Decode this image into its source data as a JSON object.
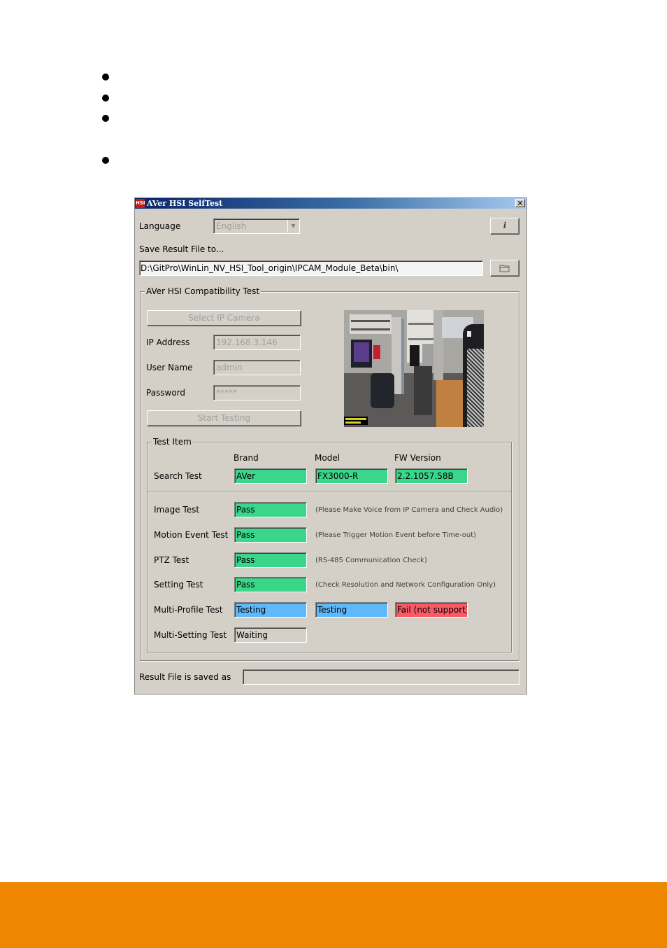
{
  "window": {
    "title": "AVer HSI SelfTest",
    "icon_text": "HSI",
    "close_glyph": "✕"
  },
  "language": {
    "label": "Language",
    "value": "English"
  },
  "info_button_glyph": "i",
  "save": {
    "label": "Save Result File to...",
    "path": "D:\\GitPro\\WinLin_NV_HSI_Tool_origin\\IPCAM_Module_Beta\\bin\\"
  },
  "compat_group": {
    "caption": "AVer HSI Compatibility Test",
    "select_camera_label": "Select IP Camera",
    "ip_label": "IP Address",
    "ip_value": "192.168.3.146",
    "user_label": "User Name",
    "user_value": "admin",
    "password_label": "Password",
    "password_value": "*****",
    "start_label": "Start Testing"
  },
  "test_item": {
    "caption": "Test Item",
    "headers": [
      "Brand",
      "Model",
      "FW Version"
    ],
    "search": {
      "label": "Search Test",
      "brand": "AVer",
      "model": "FX3000-R",
      "fw": "2.2.1057.58B"
    },
    "rows": [
      {
        "label": "Image Test",
        "result": "Pass",
        "note": "(Please Make Voice from IP Camera and Check Audio)"
      },
      {
        "label": "Motion Event Test",
        "result": "Pass",
        "note": "(Please Trigger Motion Event before Time-out)"
      },
      {
        "label": "PTZ Test",
        "result": "Pass",
        "note": "(RS-485 Communication Check)"
      },
      {
        "label": "Setting Test",
        "result": "Pass",
        "note": "(Check Resolution and Network Configuration Only)"
      }
    ],
    "multi_profile": {
      "label": "Multi-Profile Test",
      "r1": "Testing",
      "r2": "Testing",
      "r3": "Fail (not support)"
    },
    "multi_setting": {
      "label": "Multi-Setting Test",
      "result": "Waiting"
    }
  },
  "result_file": {
    "label": "Result File is saved as",
    "value": ""
  },
  "colors": {
    "pass": "#3ad68a",
    "testing": "#5fb8fa",
    "fail": "#fa5a66",
    "waiting": "#d4d0c8",
    "footer": "#ee8600"
  }
}
